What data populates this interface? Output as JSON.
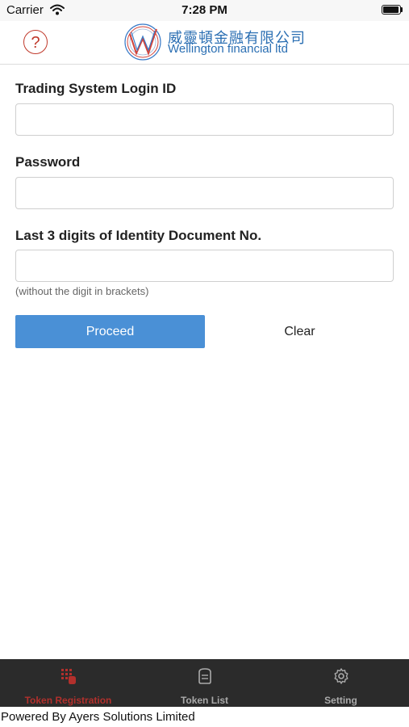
{
  "status_bar": {
    "carrier": "Carrier",
    "time": "7:28 PM"
  },
  "header": {
    "help_icon_glyph": "?",
    "brand_chinese": "威靈頓金融有限公司",
    "brand_english": "Wellington financial ltd",
    "help_icon": "question-circle-icon",
    "logo_icon": "wellington-logo"
  },
  "form": {
    "login_id_label": "Trading System Login ID",
    "login_id_value": "",
    "password_label": "Password",
    "password_value": "",
    "id_digits_label": "Last 3 digits of Identity Document No.",
    "id_digits_value": "",
    "id_digits_hint": "(without the digit in brackets)"
  },
  "actions": {
    "proceed_label": "Proceed",
    "clear_label": "Clear"
  },
  "tab_bar": {
    "tabs": [
      {
        "label": "Token Registration",
        "icon": "grid-hand-icon",
        "active": true
      },
      {
        "label": "Token List",
        "icon": "token-device-icon",
        "active": false
      },
      {
        "label": "Setting",
        "icon": "gear-icon",
        "active": false
      }
    ]
  },
  "footer": {
    "text": "Powered By Ayers Solutions Limited"
  },
  "colors": {
    "accent_blue": "#4a90d6",
    "brand_blue": "#2b6fb3",
    "accent_red": "#b2302c",
    "tab_bar_bg": "#2b2b2b"
  }
}
